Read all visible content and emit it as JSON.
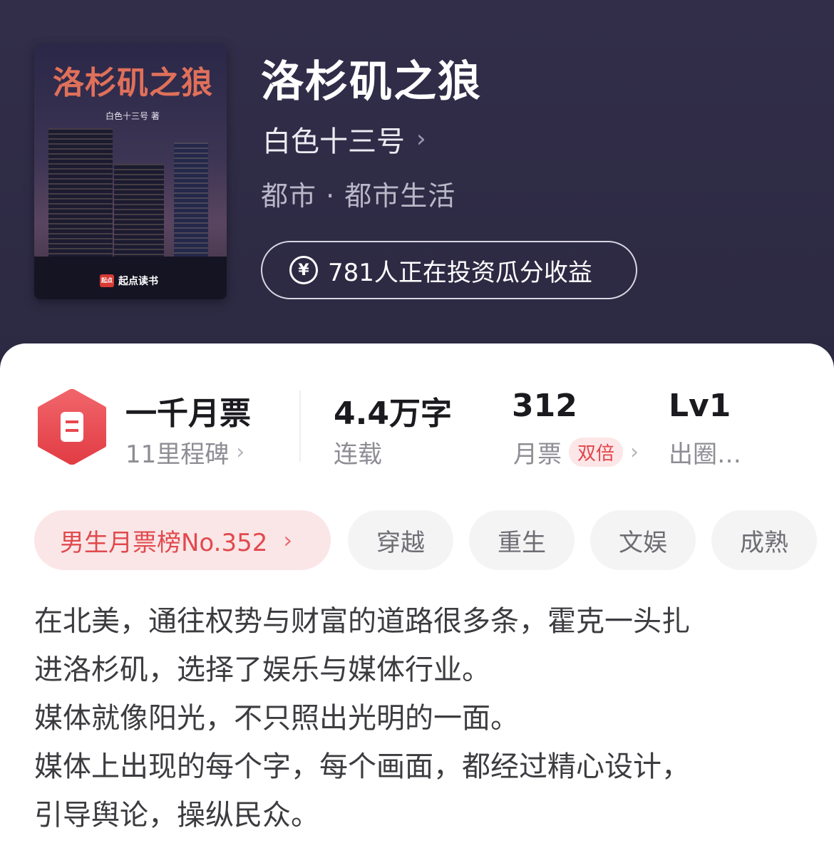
{
  "book": {
    "cover_title": "洛杉矶之狼",
    "cover_author": "白色十三号 著",
    "cover_brand": "起点读书",
    "cover_brand_logo": "起点",
    "title": "洛杉矶之狼",
    "author": "白色十三号",
    "genre": "都市 · 都市生活",
    "invest_text": "781人正在投资瓜分收益"
  },
  "stats": {
    "milestone": {
      "title": "一千月票",
      "sub": "11里程碑"
    },
    "words": {
      "title": "4.4万字",
      "sub": "连载"
    },
    "tickets": {
      "title": "312",
      "sub": "月票",
      "badge": "双倍"
    },
    "level": {
      "title": "Lv1",
      "sub": "出圈…"
    }
  },
  "tags": {
    "rank": "男生月票榜No.352",
    "items": [
      "穿越",
      "重生",
      "文娱",
      "成熟"
    ]
  },
  "description": [
    "在北美，通往权势与财富的道路很多条，霍克一头扎",
    "进洛杉矶，选择了娱乐与媒体行业。",
    "媒体就像阳光，不只照出光明的一面。",
    "媒体上出现的每个字，每个画面，都经过精心设计，",
    "引导舆论，操纵民众。"
  ],
  "colors": {
    "header_bg": "#2f2c45",
    "accent_red": "#e2454a",
    "card_bg": "#ffffff"
  }
}
